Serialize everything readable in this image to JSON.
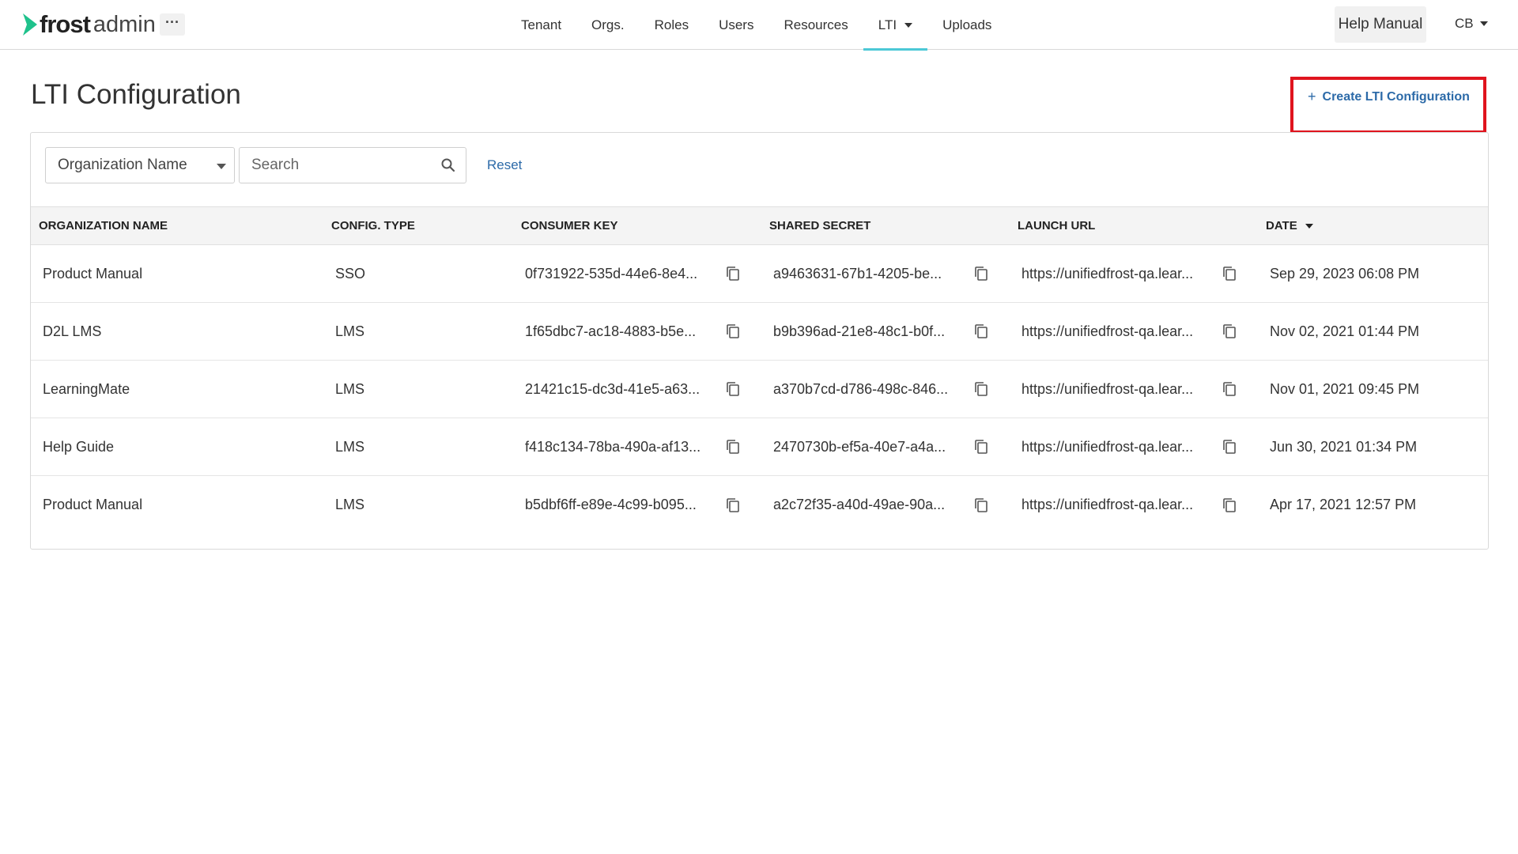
{
  "app": {
    "brand_bold": "frost",
    "brand_light": "admin",
    "more_label": "···"
  },
  "nav": {
    "items": [
      {
        "label": "Tenant"
      },
      {
        "label": "Orgs."
      },
      {
        "label": "Roles"
      },
      {
        "label": "Users"
      },
      {
        "label": "Resources"
      },
      {
        "label": "LTI"
      },
      {
        "label": "Uploads"
      }
    ],
    "active": "LTI"
  },
  "header_right": {
    "help_label": "Help Manual",
    "user_initials": "CB"
  },
  "page": {
    "title": "LTI Configuration",
    "create_label": "Create LTI Configuration"
  },
  "filters": {
    "select_value": "Organization Name",
    "search_placeholder": "Search",
    "reset_label": "Reset"
  },
  "table": {
    "columns": [
      "ORGANIZATION NAME",
      "CONFIG. TYPE",
      "CONSUMER KEY",
      "SHARED SECRET",
      "LAUNCH URL",
      "DATE"
    ],
    "rows": [
      {
        "org": "Product Manual",
        "type": "SSO",
        "key": "0f731922-535d-44e6-8e4...",
        "secret": "a9463631-67b1-4205-be...",
        "url": "https://unifiedfrost-qa.lear...",
        "date": "Sep 29, 2023 06:08 PM"
      },
      {
        "org": "D2L LMS",
        "type": "LMS",
        "key": "1f65dbc7-ac18-4883-b5e...",
        "secret": "b9b396ad-21e8-48c1-b0f...",
        "url": "https://unifiedfrost-qa.lear...",
        "date": "Nov 02, 2021 01:44 PM"
      },
      {
        "org": "LearningMate",
        "type": "LMS",
        "key": "21421c15-dc3d-41e5-a63...",
        "secret": "a370b7cd-d786-498c-846...",
        "url": "https://unifiedfrost-qa.lear...",
        "date": "Nov 01, 2021 09:45 PM"
      },
      {
        "org": "Help Guide",
        "type": "LMS",
        "key": "f418c134-78ba-490a-af13...",
        "secret": "2470730b-ef5a-40e7-a4a...",
        "url": "https://unifiedfrost-qa.lear...",
        "date": "Jun 30, 2021 01:34 PM"
      },
      {
        "org": "Product Manual",
        "type": "LMS",
        "key": "b5dbf6ff-e89e-4c99-b095...",
        "secret": "a2c72f35-a40d-49ae-90a...",
        "url": "https://unifiedfrost-qa.lear...",
        "date": "Apr 17, 2021 12:57 PM"
      }
    ]
  },
  "colors": {
    "accent": "#4cc8d6",
    "link": "#2c6aa8",
    "highlight": "#e0141e",
    "logo": "#1fc28c"
  },
  "icons": {
    "logo": "chevron-logo-icon",
    "search": "search-icon",
    "copy": "copy-icon",
    "dropdown": "caret-down-icon"
  }
}
